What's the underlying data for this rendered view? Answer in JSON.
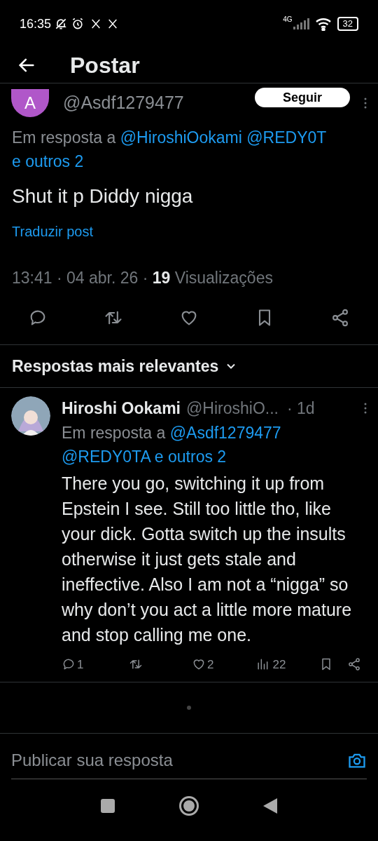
{
  "status_bar": {
    "time": "16:35",
    "network": "4G",
    "battery": "32"
  },
  "header": {
    "title": "Postar"
  },
  "post": {
    "avatar_letter": "A",
    "handle": "@Asdf1279477",
    "follow_button": "Seguir",
    "reply_prefix": "Em resposta a",
    "reply_to": [
      "@HiroshiOokami",
      "@REDY0T"
    ],
    "reply_more": "e outros 2",
    "text": "Shut it p Diddy nigga",
    "translate": "Traduzir post",
    "time": "13:41 · 04 abr. 26 ·",
    "views_count": "19",
    "views_label": "Visualizações"
  },
  "replies_filter": "Respostas mais relevantes",
  "reply": {
    "name": "Hiroshi Ookami",
    "handle": "@HiroshiO...",
    "age": "· 1d",
    "reply_prefix": "Em resposta a",
    "reply_to": [
      "@Asdf1279477",
      "@REDY0TA"
    ],
    "reply_more": "e outros 2",
    "text": "There you go, switching it up from Epstein I see. Still too little tho, like your dick. Gotta switch up the insults otherwise it just gets stale and ineffective. Also I am not a “nigga” so why don’t you act a little more mature and stop calling me one.",
    "replies": "1",
    "likes": "2",
    "views": "22"
  },
  "composer": {
    "placeholder": "Publicar sua resposta"
  }
}
